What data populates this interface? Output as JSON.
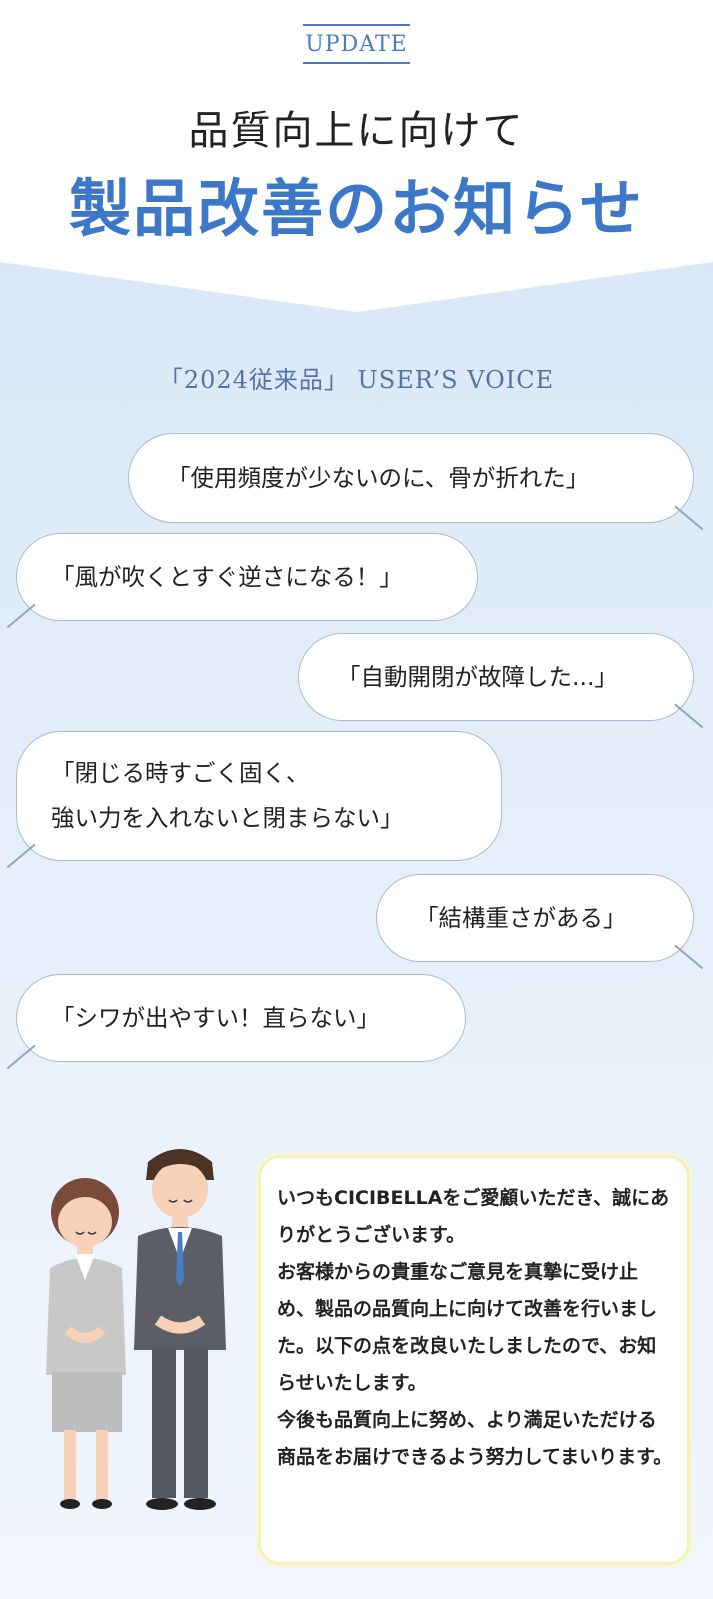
{
  "header": {
    "update_label": "UPDATE",
    "title_line1": "品質向上に向けて",
    "title_line2": "製品改善のお知らせ"
  },
  "voices": {
    "heading": "「2024従来品」 USER’S VOICE",
    "bubbles": [
      {
        "text": "「使用頻度が少ないのに、骨が折れた」",
        "side": "right"
      },
      {
        "text": "「風が吹くとすぐ逆さになる！」",
        "side": "left"
      },
      {
        "text": "「自動開閉が故障した...」",
        "side": "right"
      },
      {
        "text": "「閉じる時すごく固く、\n 強い力を入れないと閉まらない」",
        "side": "left"
      },
      {
        "text": "「結構重さがある」",
        "side": "right"
      },
      {
        "text": "「シワが出やすい！直らない」",
        "side": "left"
      }
    ]
  },
  "notice": {
    "text": "いつもCICIBELLAをご愛顧いただき、誠にありがとうございます。\nお客様からの貴重なご意見を真摯に受け止め、製品の品質向上に向けて改善を行いました。以下の点を改良いたしましたので、お知らせいたします。\n今後も品質向上に努め、より満足いただける商品をお届けできるよう努力してまいります。"
  },
  "colors": {
    "accent": "#3d78c8",
    "bubble_border": "#a9bccf",
    "notice_border": "#f1f1b8"
  },
  "illustration": {
    "name": "bowing-staff-illustration"
  }
}
